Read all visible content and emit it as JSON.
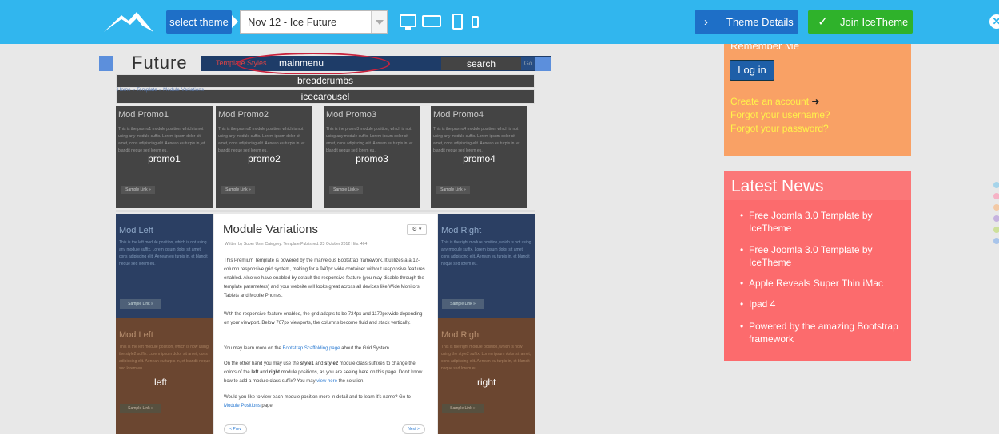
{
  "topbar": {
    "select_label": "select theme",
    "theme_value": "Nov 12 - Ice Future",
    "theme_details": "Theme Details",
    "join": "Join IceTheme",
    "bg": "#31b6ee",
    "button_blue": "#1e6fc7",
    "button_green": "#2fb22b"
  },
  "preview": {
    "module_title": "Future",
    "nav_menu": "Template  Styles",
    "mainmenu": "mainmenu",
    "search": "search",
    "go": "Go",
    "breadcrumbs": "breadcrumbs",
    "breadcrumb_small": "Home  »  Template  »  Module Variations",
    "icecarousel": "icecarousel",
    "promos": [
      {
        "title": "Mod Promo1",
        "text": "This is the promo1 module position, which is not using any module suffix. Lorem ipsum dolor sit amet, cons adipiscing elit. Aenean eu turpis in, et blandit neque sed lorem eu.",
        "overlay": "promo1",
        "button": "Sample Link »"
      },
      {
        "title": "Mod Promo2",
        "text": "This is the promo2 module position, which is not using any module suffix. Lorem ipsum dolor sit amet, cons adipiscing elit. Aenean eu turpis in, et blandit neque sed lorem eu.",
        "overlay": "promo2",
        "button": "Sample Link »"
      },
      {
        "title": "Mod Promo3",
        "text": "This is the promo3 module position, which is not using any module suffix. Lorem ipsum dolor sit amet, cons adipiscing elit. Aenean eu turpis in, et blandit neque sed lorem eu.",
        "overlay": "promo3",
        "button": "Sample Link »"
      },
      {
        "title": "Mod Promo4",
        "text": "This is the promo4 module position, which is not using any module suffix. Lorem ipsum dolor sit amet, cons adipiscing elit. Aenean eu turpis in, et blandit neque sed lorem eu.",
        "overlay": "promo4",
        "button": "Sample Link »"
      }
    ],
    "left_top": {
      "title": "Mod Left",
      "text": "This is the left module position, which is not using any module suffix. Lorem ipsum dolor sit amet, cons adipiscing elit. Aenean eu turpis in, et blandit neque sed lorem eu.",
      "button": "Sample Link »"
    },
    "left_bottom": {
      "title": "Mod Left",
      "text": "This is the left module position, which is now using the style2 suffix. Lorem ipsum dolor sit amet, cons adipiscing elit. Aenean eu turpis in, et blandit neque sed lorem eu.",
      "button": "Sample Link »",
      "overlay": "left"
    },
    "right_top": {
      "title": "Mod Right",
      "text": "This is the right module position, which is not using any module suffix. Lorem ipsum dolor sit amet, cons adipiscing elit. Aenean eu turpis in, et blandit neque sed lorem eu.",
      "button": "Sample Link »"
    },
    "right_bottom": {
      "title": "Mod Right",
      "text": "This is the right module position, which is now using the style2 suffix. Lorem ipsum dolor sit amet, cons adipiscing elit. Aenean eu turpis in, et blandit neque sed lorem eu.",
      "button": "Sample Link »",
      "overlay": "right"
    },
    "article": {
      "title": "Module Variations",
      "gear": "⚙ ▾",
      "meta": "Written by Super User    Category: Template    Published: 23 October 2012    Hits: 464",
      "p1": "This Premium Template is powered by the marvelous Bootstrap framework. It utilizes a a 12-column responsive grid system, making for a 940px wide container without responsive features enabled. Also we have enabled by default the responsive feature (you may disable through the template parameters) and your website will looks great across all devices like Wide Monitors, Tablets and Mobile Phones.",
      "p2": "With the responsive feature enabled, the grid adapts to be 724px and 1170px wide depending on your viewport. Below 767px viewports, the columns become fluid and stack vertically.",
      "p3_a": "You may learn more on the ",
      "p3_link": "Bootstrap Scaffolding page",
      "p3_b": " about the Grid System",
      "p4_a": "On the other hand you may use the ",
      "p4_s1": "style1",
      "p4_b": " and ",
      "p4_s2": "style2",
      "p4_c": " module class suffixes to change the colors of the ",
      "p4_left": "left",
      "p4_d": " and ",
      "p4_right": "right",
      "p4_e": " module positions, as you are seeing here on this page. Don't know how to add a module class suffix? You may ",
      "p4_link": "view here",
      "p4_f": " the solution.",
      "p5_a": "Would you like to view each module position more in detail and to learn it's name? Go to ",
      "p5_link": "Module Positions",
      "p5_b": " page",
      "prev": "< Prev",
      "next": "Next >"
    }
  },
  "login": {
    "remember": "Remember Me",
    "button": "Log in",
    "create": "Create an account",
    "forgot_user": "Forgot your username?",
    "forgot_pass": "Forgot your password?",
    "bg": "#f9a165",
    "link_color": "#fff24a"
  },
  "news": {
    "title": "Latest News",
    "items": [
      "Free Joomla 3.0 Template by IceTheme",
      "Free Joomla 3.0 Template by IceTheme",
      "Apple Reveals Super Thin iMac",
      "Ipad 4",
      "Powered by the amazing Bootstrap framework"
    ],
    "bg": "#fc6b6d"
  },
  "style_dots": [
    "#a6d4ea",
    "#f6b3c6",
    "#f3c9a5",
    "#c6b2df",
    "#cde09b",
    "#a8c4ea"
  ]
}
